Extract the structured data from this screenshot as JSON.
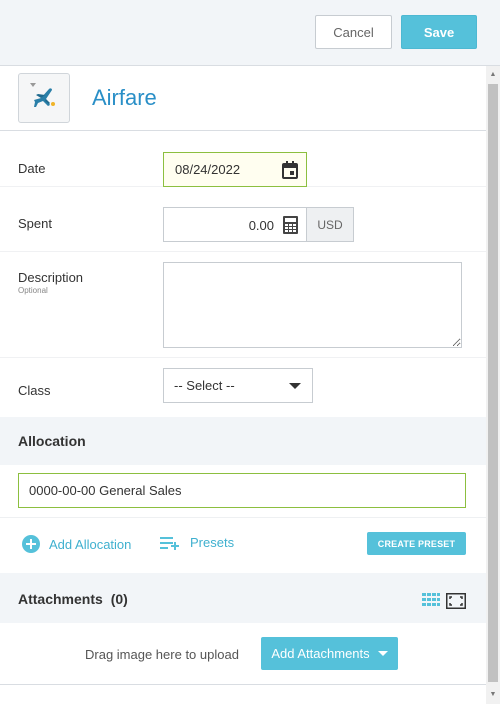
{
  "toolbar": {
    "cancel_label": "Cancel",
    "save_label": "Save"
  },
  "category": {
    "name": "Airfare",
    "icon": "airplane-icon"
  },
  "form": {
    "date": {
      "label": "Date",
      "value": "08/24/2022"
    },
    "spent": {
      "label": "Spent",
      "value": "0.00",
      "currency": "USD"
    },
    "description": {
      "label": "Description",
      "sublabel": "Optional",
      "value": ""
    },
    "class": {
      "label": "Class",
      "selected": "-- Select --"
    }
  },
  "allocation": {
    "title": "Allocation",
    "value": "0000-00-00 General Sales",
    "add_label": "Add Allocation",
    "presets_label": "Presets",
    "create_preset_label": "CREATE PRESET"
  },
  "attachments": {
    "title": "Attachments",
    "count": "(0)",
    "upload_hint": "Drag image here to upload",
    "add_label": "Add Attachments"
  },
  "colors": {
    "accent": "#55c1da",
    "link": "#2a8fc7",
    "valid_border": "#8cbf3f"
  }
}
